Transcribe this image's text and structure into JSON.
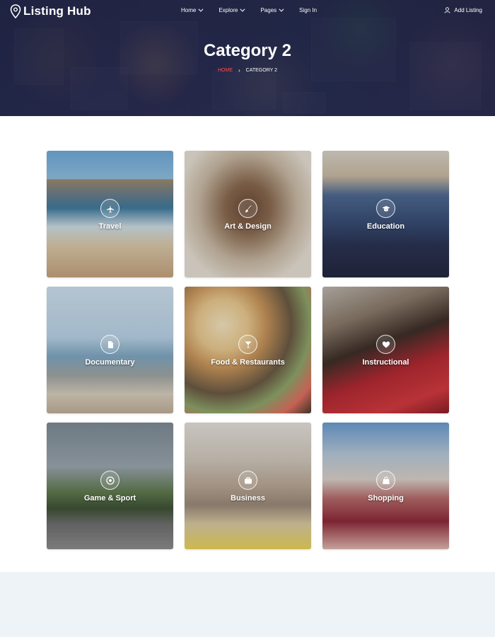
{
  "header": {
    "logo_text": "Listing Hub",
    "menu": [
      {
        "label": "Home",
        "has_dropdown": true
      },
      {
        "label": "Explore",
        "has_dropdown": true
      },
      {
        "label": "Pages",
        "has_dropdown": true
      },
      {
        "label": "Sign In",
        "has_dropdown": false
      }
    ],
    "add_listing_label": "Add Listing"
  },
  "hero": {
    "title": "Category 2",
    "breadcrumb": {
      "home": "HOME",
      "separator": "›",
      "current": "CATEGORY 2"
    }
  },
  "categories": [
    {
      "label": "Travel",
      "icon": "plane-icon"
    },
    {
      "label": "Art & Design",
      "icon": "brush-icon"
    },
    {
      "label": "Education",
      "icon": "graduation-cap-icon"
    },
    {
      "label": "Documentary",
      "icon": "document-icon"
    },
    {
      "label": "Food & Restaurants",
      "icon": "cocktail-icon"
    },
    {
      "label": "Instructional",
      "icon": "heart-icon"
    },
    {
      "label": "Game & Sport",
      "icon": "soccer-ball-icon"
    },
    {
      "label": "Business",
      "icon": "briefcase-icon"
    },
    {
      "label": "Shopping",
      "icon": "shopping-bag-icon"
    }
  ],
  "colors": {
    "breadcrumb_home": "#ff4d4d",
    "hero_overlay": "#1c2040",
    "footer_band": "#edf3f7"
  }
}
